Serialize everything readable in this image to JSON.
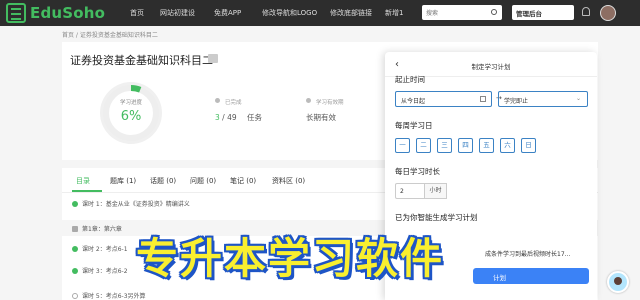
{
  "nav": {
    "logo": "EduSoho",
    "items": [
      "首页",
      "网站初建设",
      "免费APP",
      "修改导航和LOGO",
      "修改底部链接",
      "新增1"
    ],
    "search_placeholder": "搜索",
    "admin_label": "管理后台"
  },
  "breadcrumb": "首页 / 证券投资基金基础知识科目二",
  "course": {
    "title": "证券投资基金基础知识科目二",
    "progress_label": "学习进度",
    "progress_value": "6%",
    "progress_fraction": 0.06,
    "tasks_label": "已完成",
    "tasks_done": "3",
    "tasks_total": "/ 49",
    "tasks_unit": "任务",
    "validity_label": "学习有效期",
    "validity_value": "长期有效"
  },
  "tabs": [
    {
      "label": "目录"
    },
    {
      "label": "题库 (1)"
    },
    {
      "label": "话题 (0)"
    },
    {
      "label": "问题 (0)"
    },
    {
      "label": "笔记 (0)"
    },
    {
      "label": "资料区 (0)"
    }
  ],
  "lessons": [
    "课时 1：基金从业《证券投资》精编讲义",
    "第1章：第六章",
    "课时 2：考点6-1",
    "课时 3：考点6-2",
    "课时 4：考点6-3",
    "课时 5：考点6-3另外算"
  ],
  "drawer": {
    "back": "‹",
    "title": "制定学习计划",
    "start_label": "起止时间",
    "start_value": "从今日起",
    "end_value": "学完即止",
    "days_label": "每周学习日",
    "days": [
      "一",
      "二",
      "三",
      "四",
      "五",
      "六",
      "日"
    ],
    "hours_label": "每日学习时长",
    "hours_value": "2",
    "hours_unit": "小时",
    "plan_label": "已为你智能生成学习计划",
    "plan_text": "成条件学习到最后视频时长17...",
    "plan_button": "计划"
  },
  "banner": "专升本学习软件",
  "colors": {
    "accent": "#43bc60",
    "nav_bg": "#2d2d2d",
    "blue": "#3b82c4",
    "banner": "#f9ef2f"
  }
}
